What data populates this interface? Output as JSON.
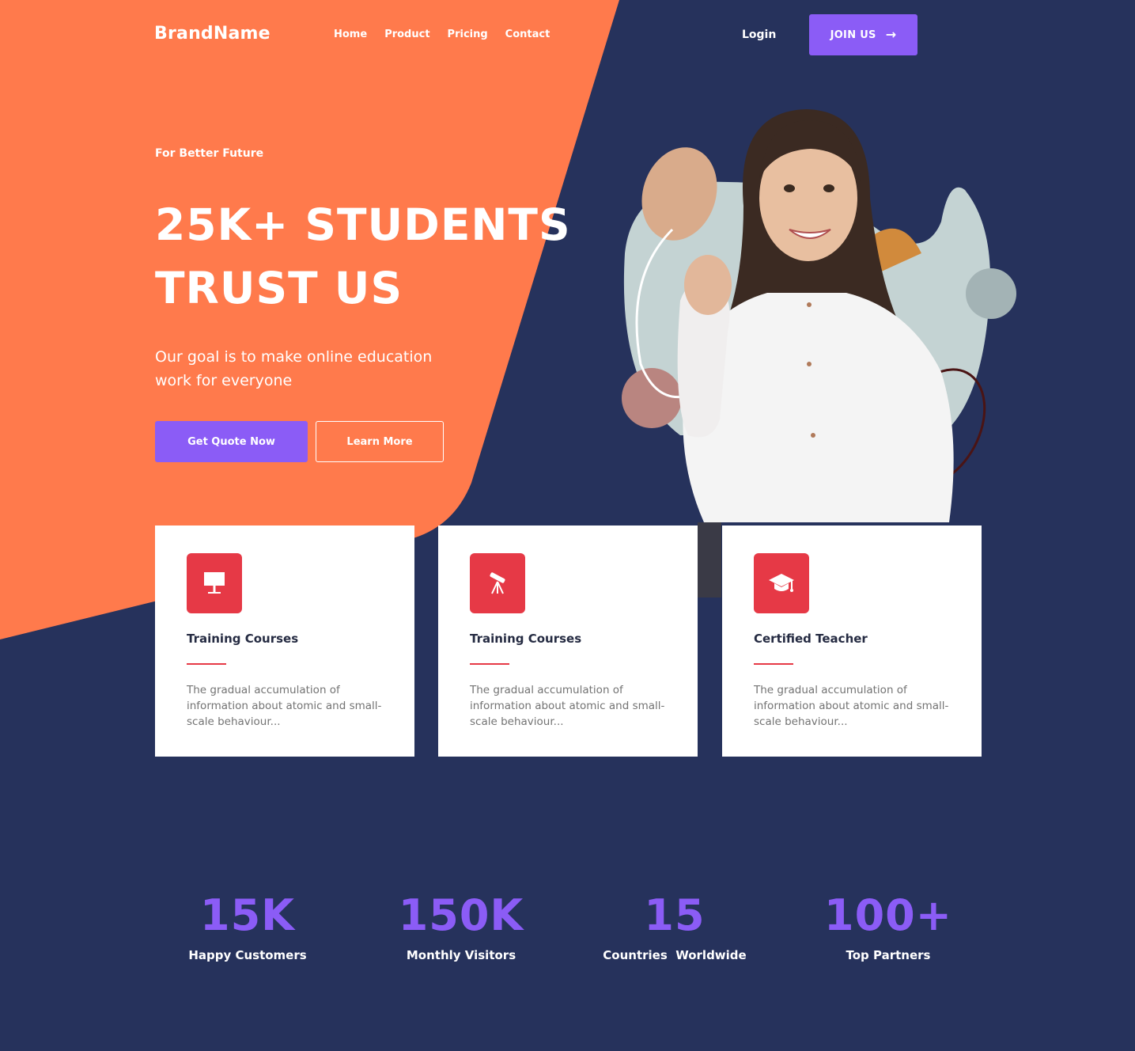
{
  "colors": {
    "navy": "#26325c",
    "orange": "#ff7a4c",
    "purple": "#8b5cf6",
    "red": "#e63946"
  },
  "navbar": {
    "brand": "BrandName",
    "links": [
      "Home",
      "Product",
      "Pricing",
      "Contact"
    ],
    "login": "Login",
    "join": "JOIN US",
    "join_icon": "arrow-right-icon"
  },
  "hero": {
    "tagline": "For Better Future",
    "headline_line1": "25K+ STUDENTS",
    "headline_line2": "TRUST US",
    "subtitle": "Our goal is to make online education work for everyone",
    "primary_cta": "Get Quote Now",
    "secondary_cta": "Learn More"
  },
  "cards": [
    {
      "icon": "presentation-board-icon",
      "title": "Training Courses",
      "text": "The gradual accumulation of information about atomic and small-scale behaviour..."
    },
    {
      "icon": "telescope-icon",
      "title": "Training Courses",
      "text": "The gradual accumulation of information about atomic and small-scale behaviour..."
    },
    {
      "icon": "graduation-cap-icon",
      "title": "Certified Teacher",
      "text": "The gradual accumulation of information about atomic and small-scale behaviour..."
    }
  ],
  "stats": [
    {
      "value": "15K",
      "label": "Happy Customers"
    },
    {
      "value": "150K",
      "label": "Monthly Visitors"
    },
    {
      "value": "15",
      "label": "Countries  Worldwide"
    },
    {
      "value": "100+",
      "label": "Top Partners"
    }
  ]
}
